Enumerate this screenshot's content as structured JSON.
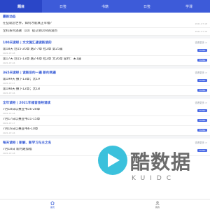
{
  "tabs": [
    {
      "label": "题目",
      "active": true
    },
    {
      "label": "日签",
      "active": false
    },
    {
      "label": "书籍",
      "active": false
    },
    {
      "label": "日签",
      "active": false
    },
    {
      "label": "学课",
      "active": false
    }
  ],
  "news_section": {
    "title": "最新动态",
    "more": "查看更多 >",
    "items": [
      {
        "text": "在些就您世界，如何才能真正幸福？",
        "date": "2021-07-18"
      },
      {
        "text": "至科系列消融（10）提交到DX4的观点",
        "date": "2021-07-18"
      }
    ]
  },
  "sections": [
    {
      "title": "100天读经 | 文文施汇通读新读的",
      "more": "查看更多 >",
      "items": [
        {
          "text": "第18天 创15-20章 路2-7章 拉2章 第25篇",
          "date": "2021-07-18",
          "badge": "Pratilai"
        },
        {
          "text": "第17天 创15-13章 路2-6章 拉2章 文26章 拿约：末1篇",
          "date": "2021-07-16",
          "badge": "Pratilai"
        }
      ]
    },
    {
      "title": "365天读经 | 读新旧约一遍 新约两遍",
      "more": "查看更多 >",
      "items": [
        {
          "text": "第199天 撒下13章；太19",
          "date": "2021-07-17",
          "badge": "Pratilai"
        },
        {
          "text": "第198天 撒下12章；太18",
          "date": "2021-07-16",
          "badge": "Pratilai"
        }
      ]
    },
    {
      "title": "全年读经 | 2021年福音圣经诵读",
      "more": "查看更多 >",
      "items": [
        {
          "text": "7月18日以赛亚书16-20章",
          "date": "2021-07-18",
          "badge": "Pratilai"
        },
        {
          "text": "7月17日以赛亚书11-15章",
          "date": "2021-07-17",
          "badge": "Pratilai"
        },
        {
          "text": "7月16日以赛亚书6-10章",
          "date": "2021-07-16",
          "badge": "Pratilai"
        }
      ]
    },
    {
      "title": "每天读经 | 新解、新学习与主之名",
      "more": "查看更多 >",
      "items": [
        {
          "text": "7月18日 新约路加福",
          "date": "2021-07-18",
          "badge": "Pratilai"
        }
      ]
    }
  ],
  "watermark": {
    "main": "酷数据",
    "sub": "KUIDC"
  },
  "bottom_nav": [
    {
      "label": "首页",
      "icon": "home-icon",
      "active": true
    },
    {
      "label": "我的",
      "icon": "user-icon",
      "active": false
    }
  ],
  "colors": {
    "accent": "#3d5bd9",
    "active_tab": "#2a46c8",
    "badge": "#4b6be6",
    "title": "#2f55d4"
  }
}
